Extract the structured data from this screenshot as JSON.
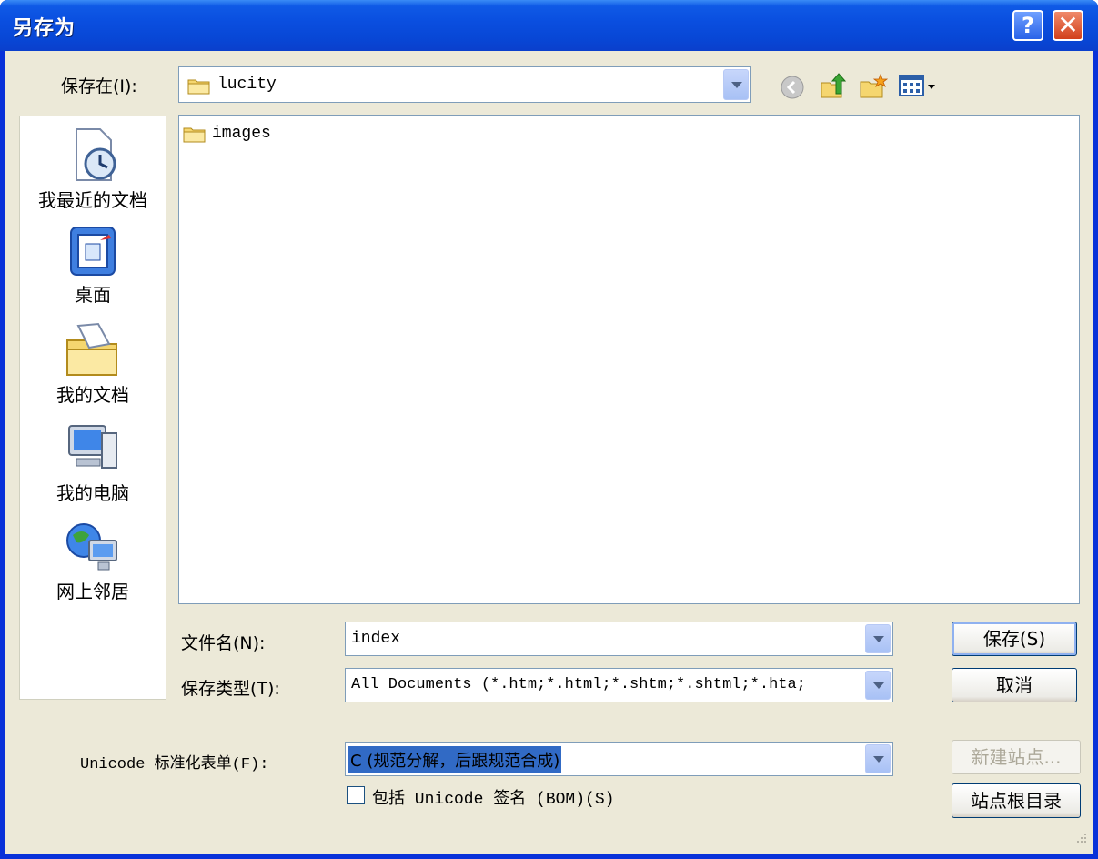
{
  "window": {
    "title": "另存为",
    "help_glyph": "?",
    "close_glyph": "✕"
  },
  "save_in": {
    "label": "保存在(I):",
    "value": "lucity"
  },
  "toolbar": {
    "back_icon": "back-icon",
    "up_icon": "up-folder-icon",
    "new_folder_icon": "new-folder-icon",
    "views_icon": "views-menu-icon"
  },
  "places": [
    {
      "label": "我最近的文档",
      "icon": "recent-documents-icon"
    },
    {
      "label": "桌面",
      "icon": "desktop-icon"
    },
    {
      "label": "我的文档",
      "icon": "my-documents-icon"
    },
    {
      "label": "我的电脑",
      "icon": "my-computer-icon"
    },
    {
      "label": "网上邻居",
      "icon": "network-places-icon"
    }
  ],
  "files": [
    {
      "name": "images",
      "type": "folder"
    }
  ],
  "filename": {
    "label": "文件名(N):",
    "value": "index"
  },
  "filetype": {
    "label": "保存类型(T):",
    "value": "All Documents (*.htm;*.html;*.shtm;*.shtml;*.hta;"
  },
  "unicode": {
    "label": "Unicode 标准化表单(F):",
    "value": "C (规范分解，后跟规范合成)"
  },
  "bom_checkbox": {
    "label": "包括 Unicode 签名 (BOM)(S)",
    "checked": false
  },
  "buttons": {
    "save": "保存(S)",
    "cancel": "取消",
    "new_site": "新建站点...",
    "site_root": "站点根目录"
  },
  "colors": {
    "title_blue": "#0a4fe0",
    "dialog_bg": "#ece9d8",
    "selection": "#316ac5"
  }
}
